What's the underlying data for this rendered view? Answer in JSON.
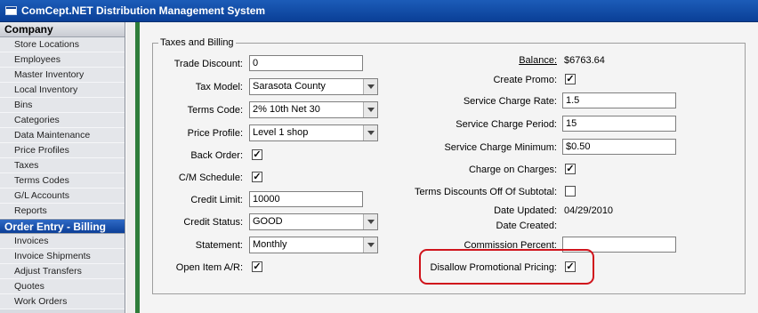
{
  "window": {
    "title": "ComCept.NET Distribution Management System"
  },
  "sidebar": {
    "company_header": "Company",
    "company_items": [
      "Store Locations",
      "Employees",
      "Master Inventory",
      "Local Inventory",
      "Bins",
      "Categories",
      "Data Maintenance",
      "Price Profiles",
      "Taxes",
      "Terms Codes",
      "G/L Accounts",
      "Reports"
    ],
    "order_header": "Order Entry - Billing",
    "order_items": [
      "Invoices",
      "Invoice Shipments",
      "Adjust Transfers",
      "Quotes",
      "Work Orders"
    ]
  },
  "form": {
    "group_title": "Taxes and Billing",
    "left": {
      "trade_discount": {
        "label": "Trade Discount:",
        "value": "0"
      },
      "tax_model": {
        "label": "Tax Model:",
        "value": "Sarasota County"
      },
      "terms_code": {
        "label": "Terms Code:",
        "value": "2% 10th Net 30"
      },
      "price_profile": {
        "label": "Price Profile:",
        "value": "Level 1 shop"
      },
      "back_order": {
        "label": "Back Order:",
        "checked": "✓"
      },
      "cm_schedule": {
        "label": "C/M Schedule:",
        "checked": "✓"
      },
      "credit_limit": {
        "label": "Credit Limit:",
        "value": "10000"
      },
      "credit_status": {
        "label": "Credit Status:",
        "value": "GOOD"
      },
      "statement": {
        "label": "Statement:",
        "value": "Monthly"
      },
      "open_item_ar": {
        "label": "Open Item A/R:",
        "checked": "✓"
      }
    },
    "right": {
      "balance": {
        "label": "Balance:",
        "value": "$6763.64"
      },
      "create_promo": {
        "label": "Create Promo:",
        "checked": "✓"
      },
      "service_charge_rate": {
        "label": "Service Charge Rate:",
        "value": "1.5"
      },
      "service_charge_period": {
        "label": "Service Charge Period:",
        "value": "15"
      },
      "service_charge_minimum": {
        "label": "Service Charge Minimum:",
        "value": "$0.50"
      },
      "charge_on_charges": {
        "label": "Charge on Charges:",
        "checked": "✓"
      },
      "terms_discounts": {
        "label": "Terms Discounts Off Of Subtotal:",
        "checked": ""
      },
      "date_updated": {
        "label": "Date Updated:",
        "value": "04/29/2010"
      },
      "date_created": {
        "label": "Date Created:",
        "value": ""
      },
      "commission_percent": {
        "label": "Commission Percent:",
        "value": ""
      },
      "disallow_promo": {
        "label": "Disallow Promotional Pricing:",
        "checked": "✓"
      }
    }
  },
  "colors": {
    "highlight": "#d0141c",
    "title_bar": "#0a3f97",
    "accent_bar": "#2f7d3a"
  }
}
